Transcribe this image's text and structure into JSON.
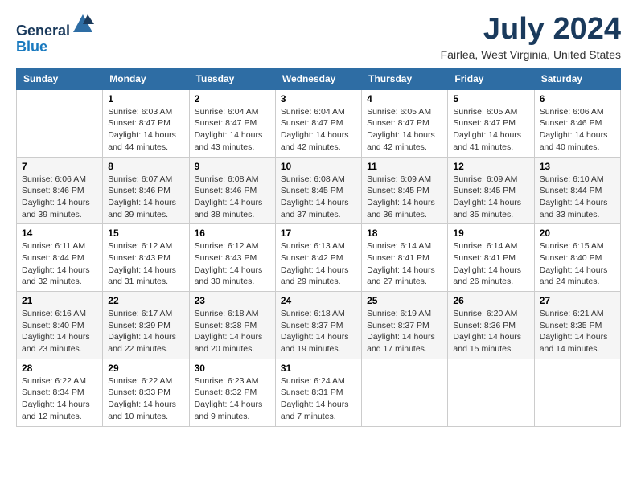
{
  "header": {
    "logo_line1": "General",
    "logo_line2": "Blue",
    "month_title": "July 2024",
    "location": "Fairlea, West Virginia, United States"
  },
  "days_of_week": [
    "Sunday",
    "Monday",
    "Tuesday",
    "Wednesday",
    "Thursday",
    "Friday",
    "Saturday"
  ],
  "weeks": [
    [
      {
        "day": "",
        "info": ""
      },
      {
        "day": "1",
        "info": "Sunrise: 6:03 AM\nSunset: 8:47 PM\nDaylight: 14 hours\nand 44 minutes."
      },
      {
        "day": "2",
        "info": "Sunrise: 6:04 AM\nSunset: 8:47 PM\nDaylight: 14 hours\nand 43 minutes."
      },
      {
        "day": "3",
        "info": "Sunrise: 6:04 AM\nSunset: 8:47 PM\nDaylight: 14 hours\nand 42 minutes."
      },
      {
        "day": "4",
        "info": "Sunrise: 6:05 AM\nSunset: 8:47 PM\nDaylight: 14 hours\nand 42 minutes."
      },
      {
        "day": "5",
        "info": "Sunrise: 6:05 AM\nSunset: 8:47 PM\nDaylight: 14 hours\nand 41 minutes."
      },
      {
        "day": "6",
        "info": "Sunrise: 6:06 AM\nSunset: 8:46 PM\nDaylight: 14 hours\nand 40 minutes."
      }
    ],
    [
      {
        "day": "7",
        "info": "Sunrise: 6:06 AM\nSunset: 8:46 PM\nDaylight: 14 hours\nand 39 minutes."
      },
      {
        "day": "8",
        "info": "Sunrise: 6:07 AM\nSunset: 8:46 PM\nDaylight: 14 hours\nand 39 minutes."
      },
      {
        "day": "9",
        "info": "Sunrise: 6:08 AM\nSunset: 8:46 PM\nDaylight: 14 hours\nand 38 minutes."
      },
      {
        "day": "10",
        "info": "Sunrise: 6:08 AM\nSunset: 8:45 PM\nDaylight: 14 hours\nand 37 minutes."
      },
      {
        "day": "11",
        "info": "Sunrise: 6:09 AM\nSunset: 8:45 PM\nDaylight: 14 hours\nand 36 minutes."
      },
      {
        "day": "12",
        "info": "Sunrise: 6:09 AM\nSunset: 8:45 PM\nDaylight: 14 hours\nand 35 minutes."
      },
      {
        "day": "13",
        "info": "Sunrise: 6:10 AM\nSunset: 8:44 PM\nDaylight: 14 hours\nand 33 minutes."
      }
    ],
    [
      {
        "day": "14",
        "info": "Sunrise: 6:11 AM\nSunset: 8:44 PM\nDaylight: 14 hours\nand 32 minutes."
      },
      {
        "day": "15",
        "info": "Sunrise: 6:12 AM\nSunset: 8:43 PM\nDaylight: 14 hours\nand 31 minutes."
      },
      {
        "day": "16",
        "info": "Sunrise: 6:12 AM\nSunset: 8:43 PM\nDaylight: 14 hours\nand 30 minutes."
      },
      {
        "day": "17",
        "info": "Sunrise: 6:13 AM\nSunset: 8:42 PM\nDaylight: 14 hours\nand 29 minutes."
      },
      {
        "day": "18",
        "info": "Sunrise: 6:14 AM\nSunset: 8:41 PM\nDaylight: 14 hours\nand 27 minutes."
      },
      {
        "day": "19",
        "info": "Sunrise: 6:14 AM\nSunset: 8:41 PM\nDaylight: 14 hours\nand 26 minutes."
      },
      {
        "day": "20",
        "info": "Sunrise: 6:15 AM\nSunset: 8:40 PM\nDaylight: 14 hours\nand 24 minutes."
      }
    ],
    [
      {
        "day": "21",
        "info": "Sunrise: 6:16 AM\nSunset: 8:40 PM\nDaylight: 14 hours\nand 23 minutes."
      },
      {
        "day": "22",
        "info": "Sunrise: 6:17 AM\nSunset: 8:39 PM\nDaylight: 14 hours\nand 22 minutes."
      },
      {
        "day": "23",
        "info": "Sunrise: 6:18 AM\nSunset: 8:38 PM\nDaylight: 14 hours\nand 20 minutes."
      },
      {
        "day": "24",
        "info": "Sunrise: 6:18 AM\nSunset: 8:37 PM\nDaylight: 14 hours\nand 19 minutes."
      },
      {
        "day": "25",
        "info": "Sunrise: 6:19 AM\nSunset: 8:37 PM\nDaylight: 14 hours\nand 17 minutes."
      },
      {
        "day": "26",
        "info": "Sunrise: 6:20 AM\nSunset: 8:36 PM\nDaylight: 14 hours\nand 15 minutes."
      },
      {
        "day": "27",
        "info": "Sunrise: 6:21 AM\nSunset: 8:35 PM\nDaylight: 14 hours\nand 14 minutes."
      }
    ],
    [
      {
        "day": "28",
        "info": "Sunrise: 6:22 AM\nSunset: 8:34 PM\nDaylight: 14 hours\nand 12 minutes."
      },
      {
        "day": "29",
        "info": "Sunrise: 6:22 AM\nSunset: 8:33 PM\nDaylight: 14 hours\nand 10 minutes."
      },
      {
        "day": "30",
        "info": "Sunrise: 6:23 AM\nSunset: 8:32 PM\nDaylight: 14 hours\nand 9 minutes."
      },
      {
        "day": "31",
        "info": "Sunrise: 6:24 AM\nSunset: 8:31 PM\nDaylight: 14 hours\nand 7 minutes."
      },
      {
        "day": "",
        "info": ""
      },
      {
        "day": "",
        "info": ""
      },
      {
        "day": "",
        "info": ""
      }
    ]
  ]
}
